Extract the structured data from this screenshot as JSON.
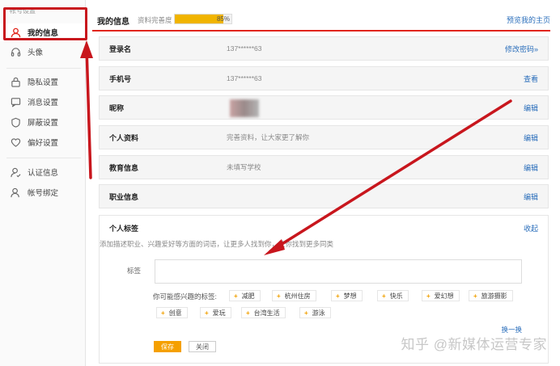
{
  "sidebar": {
    "title": "帐号设置",
    "items": [
      {
        "label": "我的信息",
        "icon": "user-icon"
      },
      {
        "label": "头像",
        "icon": "headset-icon"
      },
      {
        "label": "隐私设置",
        "icon": "lock-icon"
      },
      {
        "label": "消息设置",
        "icon": "message-icon"
      },
      {
        "label": "屏蔽设置",
        "icon": "shield-icon"
      },
      {
        "label": "偏好设置",
        "icon": "heart-icon"
      },
      {
        "label": "认证信息",
        "icon": "verify-icon"
      },
      {
        "label": "帐号绑定",
        "icon": "bind-icon"
      }
    ]
  },
  "header": {
    "title": "我的信息",
    "progress_label": "资料完善度",
    "progress_text": "85%",
    "progress_value": 0.85,
    "preview_link": "预览我的主页"
  },
  "rows": [
    {
      "label": "登录名",
      "value": "137******63",
      "action": "修改密码»"
    },
    {
      "label": "手机号",
      "value": "137******63",
      "action": "查看"
    },
    {
      "label": "昵称",
      "value": "",
      "action": "编辑"
    },
    {
      "label": "个人资料",
      "value": "完善资料，让大家更了解你",
      "action": "编辑"
    },
    {
      "label": "教育信息",
      "value": "未填写学校",
      "action": "编辑"
    },
    {
      "label": "职业信息",
      "value": "",
      "action": "编辑"
    }
  ],
  "tags": {
    "title": "个人标签",
    "collapse": "收起",
    "description": "添加描述职业、兴趣爱好等方面的词语，让更多人找到你，让你找到更多同类",
    "input_label": "标签",
    "suggest_label": "你可能感兴趣的标签:",
    "suggestions": [
      "减肥",
      "杭州住房",
      "梦想",
      "快乐",
      "爱幻想",
      "旅游摄影",
      "创意",
      "爱玩",
      "台湾生活",
      "游泳"
    ],
    "refresh": "换一换",
    "save": "保存",
    "close": "关闭"
  },
  "watermark": "知乎 @新媒体运营专家",
  "colors": {
    "accent": "#e1251b",
    "link": "#2a6ebb",
    "progress": "#f0b400",
    "annotation": "#c8161d"
  }
}
